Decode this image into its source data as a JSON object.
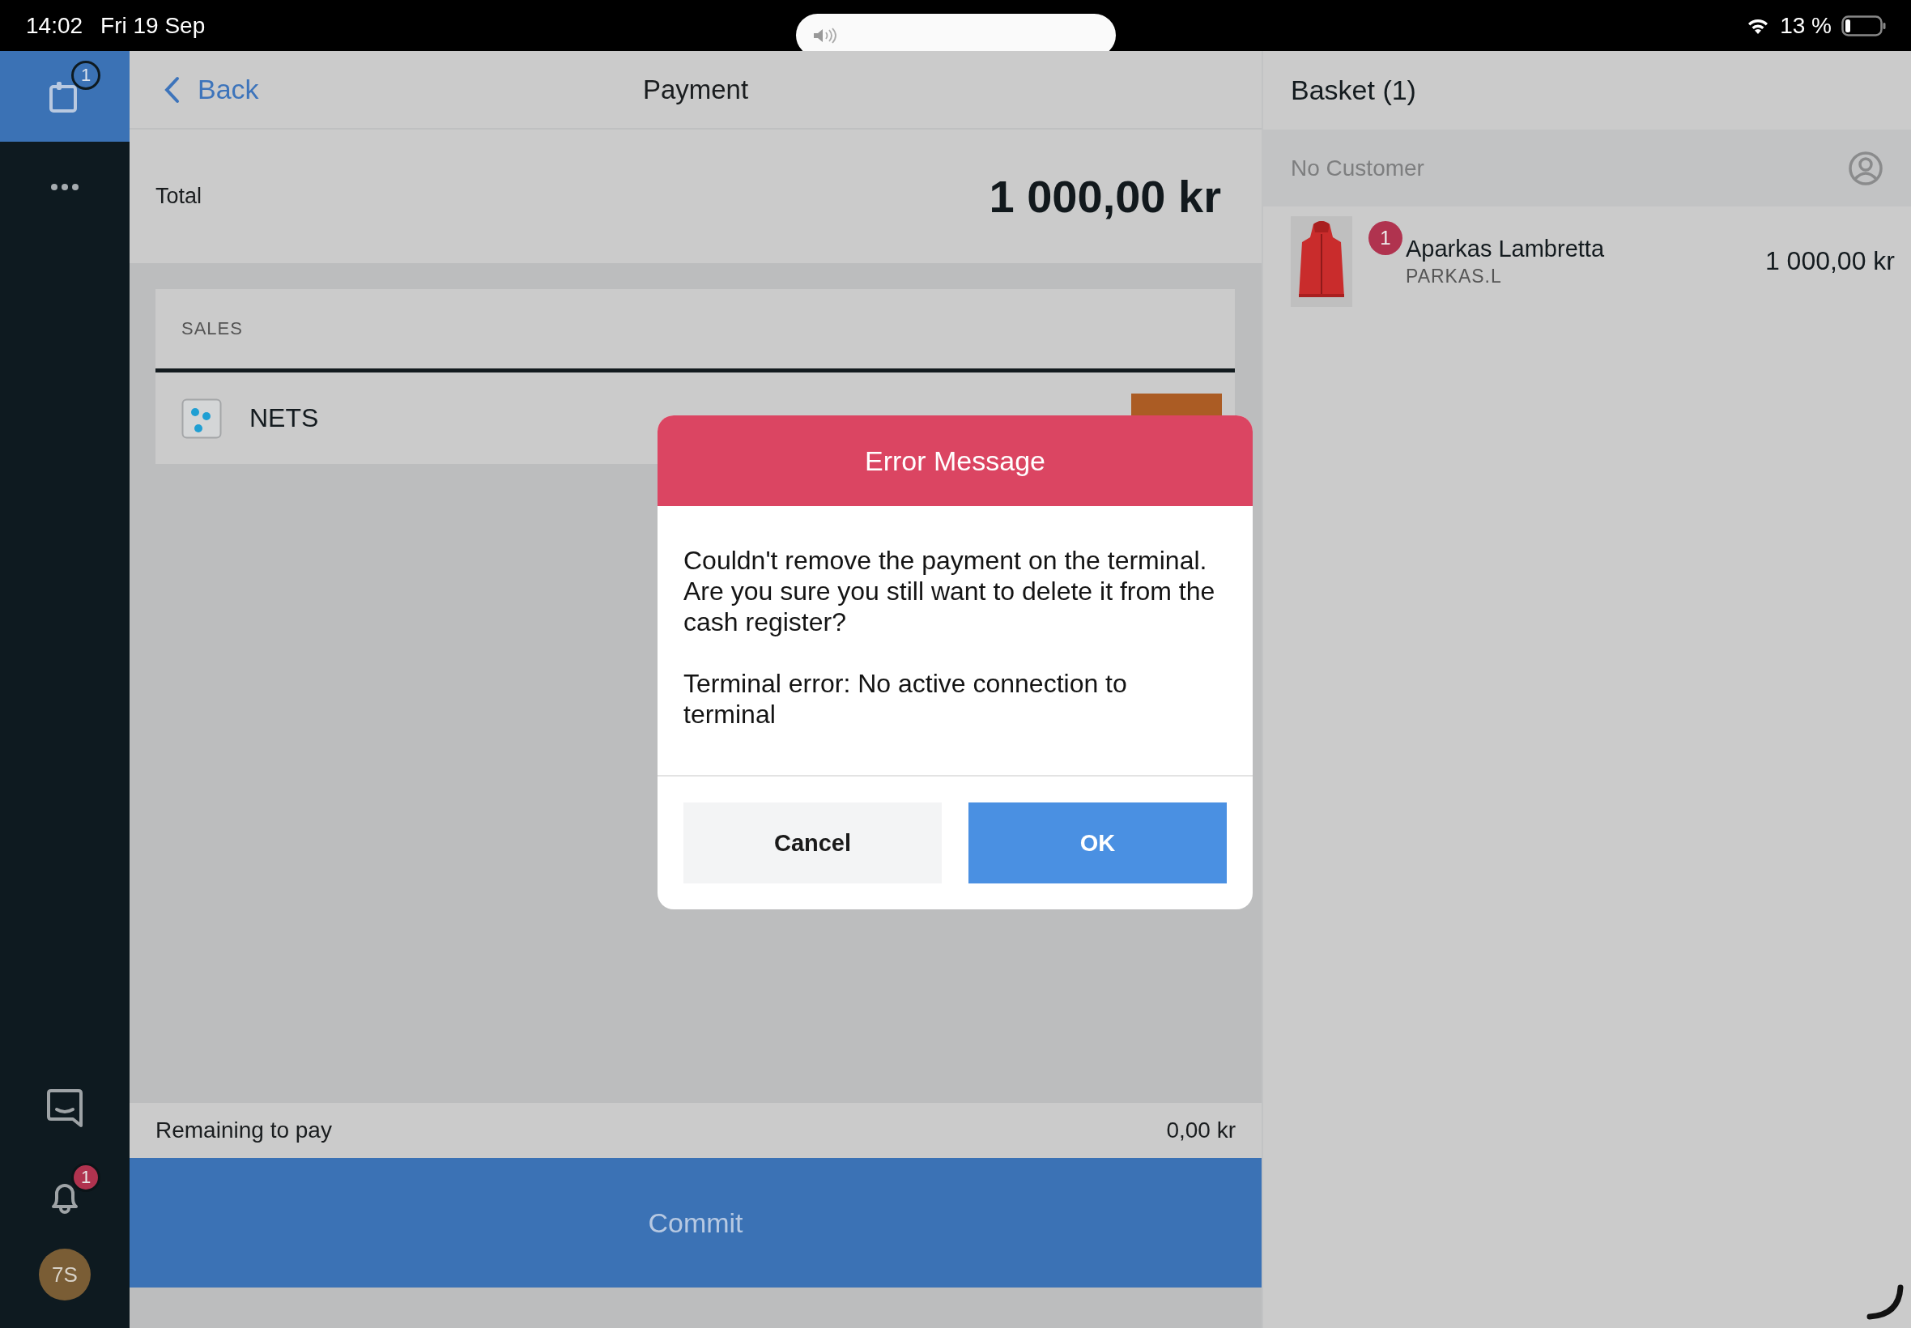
{
  "status_bar": {
    "time": "14:02",
    "date": "Fri 19 Sep",
    "battery": "13 %"
  },
  "sidebar": {
    "items": [
      {
        "kind": "basket",
        "badge": "1",
        "selected": true
      },
      {
        "kind": "more",
        "selected": false
      }
    ],
    "bottom_items": [
      {
        "kind": "chat",
        "selected": false
      },
      {
        "kind": "notifications",
        "badge": "1",
        "selected": false
      }
    ],
    "avatar": "7S"
  },
  "header": {
    "back": "Back",
    "title": "Payment"
  },
  "total": {
    "label": "Total",
    "amount": "1 000,00 kr"
  },
  "payments": {
    "section": "SALES",
    "rows": [
      {
        "name": "NETS"
      }
    ]
  },
  "remaining": {
    "label": "Remaining to pay",
    "amount": "0,00 kr"
  },
  "commit": "Commit",
  "basket": {
    "title": "Basket (1)",
    "customer": "No Customer",
    "items": [
      {
        "kind": "picture",
        "quantity": "1",
        "name": "Aparkas Lambretta",
        "sku": "PARKAS.L",
        "price": "1 000,00 kr"
      }
    ]
  },
  "dialog": {
    "title": "Error Message",
    "paragraphs": [
      "Couldn't remove the payment on the terminal. Are you sure you still want to delete it from the cash register?",
      "Terminal error: No active connection to terminal"
    ],
    "buttons": [
      {
        "label": "Cancel",
        "kind": "secondary"
      },
      {
        "label": "OK",
        "kind": "primary"
      }
    ]
  }
}
